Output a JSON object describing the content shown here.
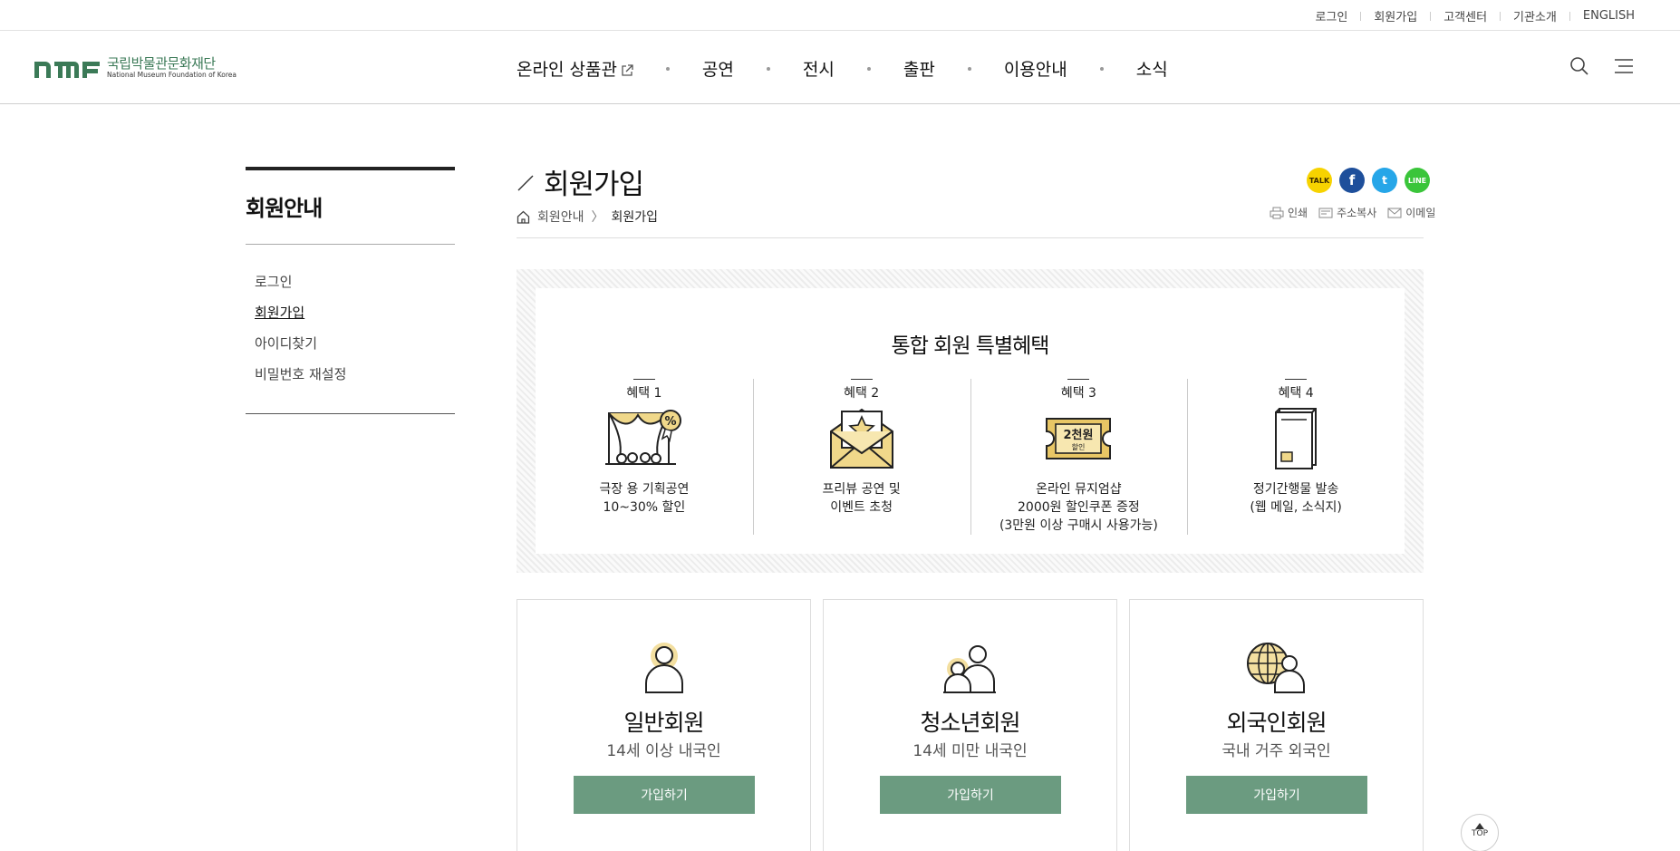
{
  "util_links": [
    "로그인",
    "회원가입",
    "고객센터",
    "기관소개",
    "ENGLISH"
  ],
  "logo": {
    "mark": "nmf",
    "ko": "국립박물관문화재단",
    "en": "National Museum Foundation of Korea",
    "color": "#3b7a57"
  },
  "gnb": [
    "온라인 상품관",
    "공연",
    "전시",
    "출판",
    "이용안내",
    "소식"
  ],
  "header_icons": {
    "search": "search-icon",
    "menu": "hamburger-menu-icon"
  },
  "sidebar": {
    "title": "회원안내",
    "items": [
      {
        "label": "로그인",
        "active": false
      },
      {
        "label": "회원가입",
        "active": true
      },
      {
        "label": "아이디찾기",
        "active": false
      },
      {
        "label": "비밀번호 재설정",
        "active": false
      }
    ]
  },
  "page": {
    "title": "회원가입",
    "breadcrumb": [
      "회원안내",
      "회원가입"
    ]
  },
  "sns": {
    "kakao": "TALK",
    "facebook": "f",
    "twitter": "t",
    "line": "LINE"
  },
  "tools": {
    "print": "인쇄",
    "copy_url": "주소복사",
    "email": "이메일"
  },
  "benefits": {
    "title": "통합 회원 특별혜택",
    "items": [
      {
        "num": "혜택 1",
        "line1": "극장 용 기획공연",
        "line2": "10~30% 할인",
        "line3": "",
        "icon": "theater-discount-icon"
      },
      {
        "num": "혜택 2",
        "line1": "프리뷰 공연 및",
        "line2": "이벤트 초청",
        "line3": "",
        "icon": "invitation-envelope-icon"
      },
      {
        "num": "혜택 3",
        "line1": "온라인 뮤지엄샵",
        "line2": "2000원 할인쿠폰 증정",
        "line3": "(3만원 이상 구매시 사용가능)",
        "icon": "coupon-ticket-icon",
        "coupon_top": "2천원",
        "coupon_bottom": "할인"
      },
      {
        "num": "혜택 4",
        "line1": "정기간행물 발송",
        "line2": "(웹 메일, 소식지)",
        "line3": "",
        "icon": "newsletter-icon"
      }
    ]
  },
  "cards": [
    {
      "title": "일반회원",
      "sub": "14세 이상 내국인",
      "button": "가입하기",
      "icon": "person-icon"
    },
    {
      "title": "청소년회원",
      "sub": "14세 미만 내국인",
      "button": "가입하기",
      "icon": "two-people-icon"
    },
    {
      "title": "외국인회원",
      "sub": "국내 거주 외국인",
      "button": "가입하기",
      "icon": "globe-person-icon"
    }
  ],
  "top_button": "TOP",
  "colors": {
    "accent_green": "#6b9b80",
    "icon_gold": "#f0d88a"
  }
}
